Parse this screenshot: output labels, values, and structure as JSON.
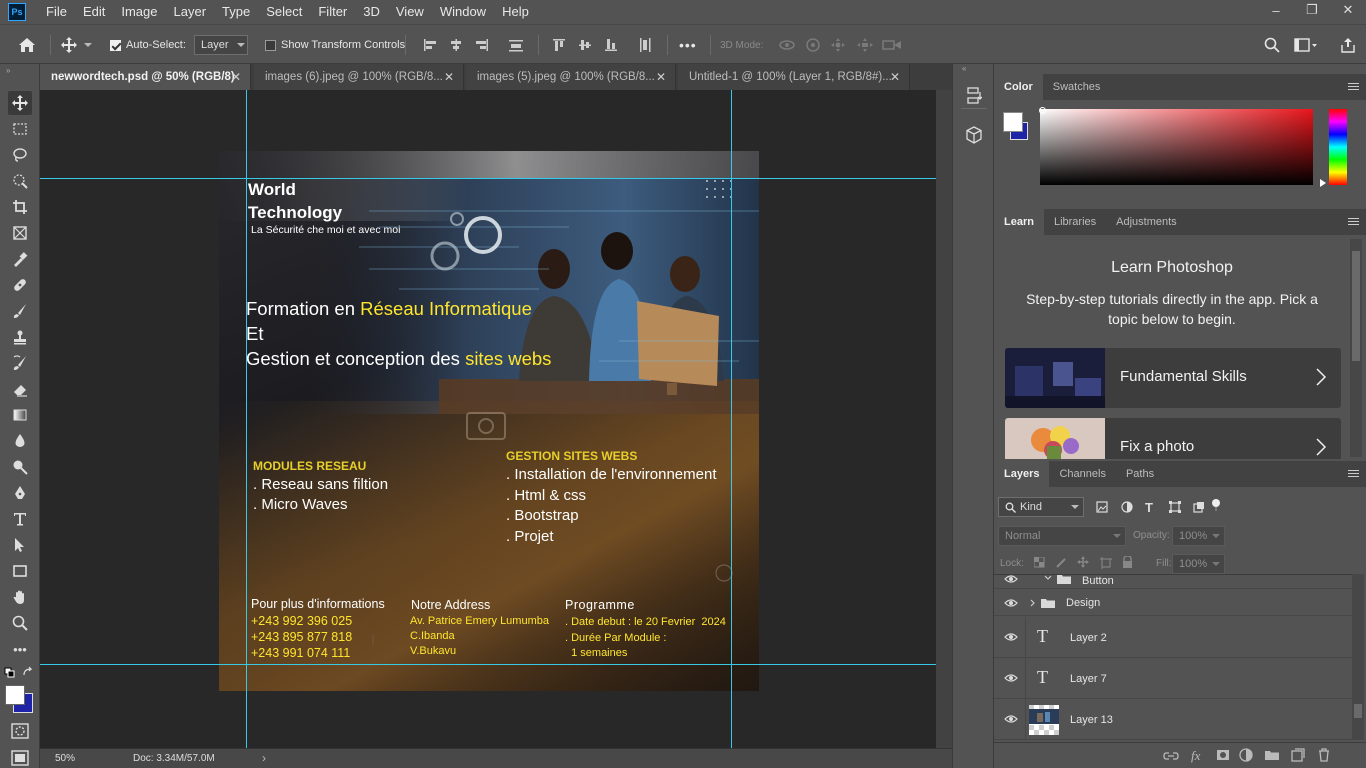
{
  "app": {
    "logo": "Ps"
  },
  "menu": [
    "File",
    "Edit",
    "Image",
    "Layer",
    "Type",
    "Select",
    "Filter",
    "3D",
    "View",
    "Window",
    "Help"
  ],
  "window_controls": {
    "minimize": "–",
    "restore": "❐",
    "close": "✕"
  },
  "options_bar": {
    "auto_select_label": "Auto-Select:",
    "auto_select_checked": true,
    "auto_select_target": "Layer",
    "show_transform_label": "Show Transform Controls",
    "show_transform_checked": false,
    "more": "•••",
    "mode_3d_label": "3D Mode:"
  },
  "tabs": [
    {
      "label": "newwordtech.psd @ 50% (RGB/8)",
      "active": true
    },
    {
      "label": "images (6).jpeg @ 100% (RGB/8...",
      "active": false
    },
    {
      "label": "images (5).jpeg @ 100% (RGB/8...",
      "active": false
    },
    {
      "label": "Untitled-1 @ 100% (Layer 1, RGB/8#)...",
      "active": false
    }
  ],
  "status": {
    "zoom": "50%",
    "doc": "Doc: 3.34M/57.0M"
  },
  "document": {
    "brand_line1": "World",
    "brand_line2": "Technology",
    "tagline": "La Sécurité che moi et avec moi",
    "headline_l1_prefix": "Formation en ",
    "headline_l1_highlight": "Réseau Informatique",
    "headline_l2": "Et",
    "headline_l3_prefix": "Gestion et conception des ",
    "headline_l3_highlight": "sites webs",
    "modules_title": "MODULES RESEAU",
    "modules_items": [
      ". Reseau sans filtion",
      ". Micro Waves"
    ],
    "gestion_title": "GESTION SITES WEBS",
    "gestion_items": [
      ". Installation de l'environnement",
      ". Html & css",
      ". Bootstrap",
      ". Projet"
    ],
    "info_title": "Pour plus d'informations",
    "phones": [
      "+243 992 396 025",
      "+243 895 877 818",
      "+243 991 074 111"
    ],
    "address_title": "Notre Address",
    "address_lines": [
      "Av. Patrice Emery Lumumba",
      "C.Ibanda",
      "V.Bukavu"
    ],
    "program_title": "Programme",
    "program_lines": [
      ". Date debut : le 20 Fevrier  2024",
      ". Durée Par Module :",
      "  1 semaines"
    ],
    "colors": {
      "highlight": "#ffe62e",
      "dark_yellow": "#e8cf2a",
      "text": "#ffffff"
    }
  },
  "color_panel": {
    "tabs": [
      "Color",
      "Swatches"
    ],
    "fg": "#ffffff",
    "bg": "#1f23a8"
  },
  "learn_panel": {
    "tabs": [
      "Learn",
      "Libraries",
      "Adjustments"
    ],
    "title": "Learn Photoshop",
    "subtitle": "Step-by-step tutorials directly in the app. Pick a topic below to begin.",
    "cards": [
      "Fundamental Skills",
      "Fix a photo"
    ]
  },
  "layers_panel": {
    "tabs": [
      "Layers",
      "Channels",
      "Paths"
    ],
    "filter_kind": "Kind",
    "blend_mode": "Normal",
    "opacity_label": "Opacity:",
    "opacity_value": "100%",
    "lock_label": "Lock:",
    "fill_label": "Fill:",
    "fill_value": "100%",
    "layers": [
      {
        "name": "Button",
        "type": "group"
      },
      {
        "name": "Design",
        "type": "group"
      },
      {
        "name": "Layer 2",
        "type": "text"
      },
      {
        "name": "Layer 7",
        "type": "text"
      },
      {
        "name": "Layer 13",
        "type": "image"
      }
    ]
  }
}
